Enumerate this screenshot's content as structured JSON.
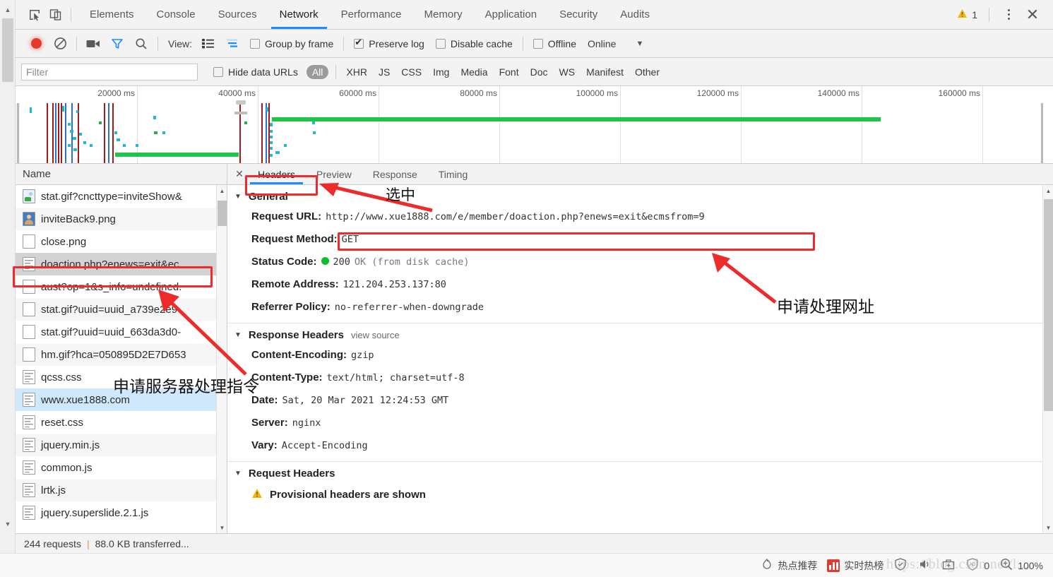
{
  "window": {
    "zoom_level": "100%"
  },
  "devtools": {
    "main_tabs": [
      {
        "label": "Elements",
        "active": false
      },
      {
        "label": "Console",
        "active": false
      },
      {
        "label": "Sources",
        "active": false
      },
      {
        "label": "Network",
        "active": true
      },
      {
        "label": "Performance",
        "active": false
      },
      {
        "label": "Memory",
        "active": false
      },
      {
        "label": "Application",
        "active": false
      },
      {
        "label": "Security",
        "active": false
      },
      {
        "label": "Audits",
        "active": false
      }
    ],
    "warning_count": "1",
    "icons": {
      "inspect": "cursor-inspect-icon",
      "device": "device-toolbar-icon",
      "more": "kebab-menu-icon",
      "close": "close-icon"
    },
    "network_toolbar": {
      "record_tooltip": "record-button",
      "clear_tooltip": "clear-button",
      "capture_screenshots": "camera-icon",
      "filter_toggle": "funnel-icon",
      "search": "search-icon",
      "view_label": "View:",
      "view_list_icon": "list-view-icon",
      "view_waterfall_icon": "waterfall-view-icon",
      "group_by_frame": {
        "label": "Group by frame",
        "checked": false
      },
      "preserve_log": {
        "label": "Preserve log",
        "checked": true
      },
      "disable_cache": {
        "label": "Disable cache",
        "checked": false
      },
      "offline": {
        "label": "Offline",
        "checked": false
      },
      "throttling": "Online",
      "throttling_caret": "chevron-down-icon"
    },
    "filter_bar": {
      "filter_placeholder": "Filter",
      "filter_value": "",
      "hide_data_urls": {
        "label": "Hide data URLs",
        "checked": false
      },
      "types": [
        {
          "label": "All",
          "selected": true
        },
        {
          "label": "XHR",
          "selected": false
        },
        {
          "label": "JS",
          "selected": false
        },
        {
          "label": "CSS",
          "selected": false
        },
        {
          "label": "Img",
          "selected": false
        },
        {
          "label": "Media",
          "selected": false
        },
        {
          "label": "Font",
          "selected": false
        },
        {
          "label": "Doc",
          "selected": false
        },
        {
          "label": "WS",
          "selected": false
        },
        {
          "label": "Manifest",
          "selected": false
        },
        {
          "label": "Other",
          "selected": false
        }
      ]
    },
    "overview": {
      "ticks": [
        "20000 ms",
        "40000 ms",
        "60000 ms",
        "80000 ms",
        "100000 ms",
        "120000 ms",
        "140000 ms",
        "160000 ms"
      ]
    },
    "request_list": {
      "column_header": "Name",
      "rows": [
        {
          "name": "stat.gif?cncttype=inviteShow&",
          "icon": "image-file-icon",
          "state": "normal"
        },
        {
          "name": "inviteBack9.png",
          "icon": "image-file-icon",
          "state": "normal"
        },
        {
          "name": "close.png",
          "icon": "blank-file-icon",
          "state": "normal"
        },
        {
          "name": "doaction.php?enews=exit&ec.",
          "icon": "document-file-icon",
          "state": "highlighted"
        },
        {
          "name": "aust?op=1&s_info=undefined.",
          "icon": "blank-file-icon",
          "state": "normal"
        },
        {
          "name": "stat.gif?uuid=uuid_a739e2e9-",
          "icon": "blank-file-icon",
          "state": "normal"
        },
        {
          "name": "stat.gif?uuid=uuid_663da3d0-",
          "icon": "blank-file-icon",
          "state": "normal"
        },
        {
          "name": "hm.gif?hca=050895D2E7D653",
          "icon": "blank-file-icon",
          "state": "normal"
        },
        {
          "name": "qcss.css",
          "icon": "document-file-icon",
          "state": "normal"
        },
        {
          "name": "www.xue1888.com",
          "icon": "document-file-icon",
          "state": "selected"
        },
        {
          "name": "reset.css",
          "icon": "document-file-icon",
          "state": "normal"
        },
        {
          "name": "jquery.min.js",
          "icon": "document-file-icon",
          "state": "normal"
        },
        {
          "name": "common.js",
          "icon": "document-file-icon",
          "state": "normal"
        },
        {
          "name": "lrtk.js",
          "icon": "document-file-icon",
          "state": "normal"
        },
        {
          "name": "jquery.superslide.2.1.js",
          "icon": "document-file-icon",
          "state": "normal"
        }
      ]
    },
    "detail": {
      "tabs": [
        {
          "label": "Headers",
          "active": true
        },
        {
          "label": "Preview",
          "active": false
        },
        {
          "label": "Response",
          "active": false
        },
        {
          "label": "Timing",
          "active": false
        }
      ],
      "general": {
        "title": "General",
        "rows": [
          {
            "key": "Request URL:",
            "value": "http://www.xue1888.com/e/member/doaction.php?enews=exit&ecmsfrom=9"
          },
          {
            "key": "Request Method:",
            "value": "GET"
          },
          {
            "key": "Status Code:",
            "value": "200 OK (from disk cache)",
            "status_code": "200",
            "status_text": "OK (from disk cache)",
            "status_color": "#0bbf2a"
          },
          {
            "key": "Remote Address:",
            "value": "121.204.253.137:80"
          },
          {
            "key": "Referrer Policy:",
            "value": "no-referrer-when-downgrade"
          }
        ]
      },
      "response_headers": {
        "title": "Response Headers",
        "view_source": "view source",
        "rows": [
          {
            "key": "Content-Encoding:",
            "value": "gzip"
          },
          {
            "key": "Content-Type:",
            "value": "text/html; charset=utf-8"
          },
          {
            "key": "Date:",
            "value": "Sat, 20 Mar 2021 12:24:53 GMT"
          },
          {
            "key": "Server:",
            "value": "nginx"
          },
          {
            "key": "Vary:",
            "value": "Accept-Encoding"
          }
        ]
      },
      "request_headers": {
        "title": "Request Headers",
        "provisional_notice": "Provisional headers are shown"
      }
    },
    "footer": {
      "requests": "244 requests",
      "separator": "|",
      "transferred": "88.0 KB transferred..."
    }
  },
  "browser_status_bar": {
    "items": [
      {
        "label": "热点推荐",
        "icon": "flame-icon"
      },
      {
        "label": "实时热榜",
        "icon": "chart-bars-icon"
      }
    ],
    "shield_icon": "shield-check-icon",
    "sound_icon": "speaker-icon",
    "toolbox_icon": "toolbox-icon",
    "adblock_count": "0",
    "adblock_icon": "adblock-shield-icon",
    "zoom_icon": "zoom-in-icon",
    "zoom_level": "100%"
  },
  "watermark": "https://blog.csdn.net/l...",
  "annotations": [
    {
      "id": "headers-tab-box",
      "type": "box",
      "text": ""
    },
    {
      "id": "selected-label",
      "type": "text",
      "text": "选中"
    },
    {
      "id": "request-url-box",
      "type": "box",
      "text": ""
    },
    {
      "id": "request-url-label",
      "type": "text",
      "text": "申请处理网址"
    },
    {
      "id": "doaction-row-box",
      "type": "box",
      "text": ""
    },
    {
      "id": "server-command-label",
      "type": "text",
      "text": "申请服务器处理指令"
    }
  ]
}
